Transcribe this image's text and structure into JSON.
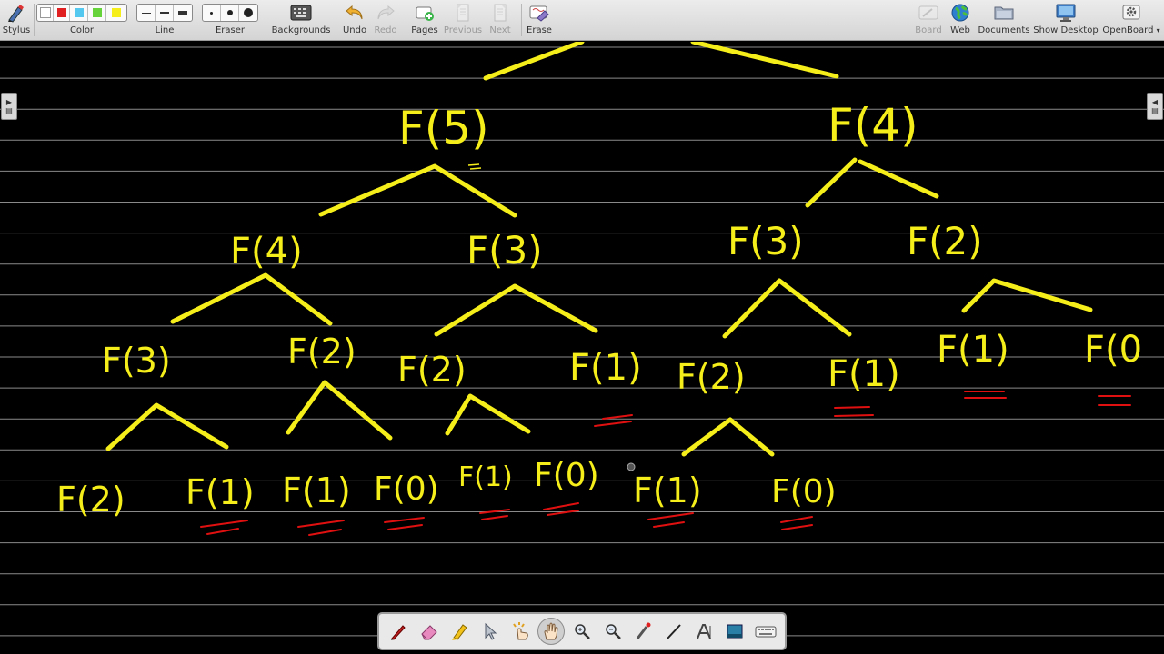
{
  "toolbar": {
    "stylus": "Stylus",
    "color": "Color",
    "line": "Line",
    "eraser": "Eraser",
    "backgrounds": "Backgrounds",
    "undo": "Undo",
    "redo": "Redo",
    "pages": "Pages",
    "previous": "Previous",
    "next": "Next",
    "erase": "Erase",
    "board": "Board",
    "web": "Web",
    "documents": "Documents",
    "show_desktop": "Show Desktop",
    "openboard": "OpenBoard"
  },
  "colors": {
    "swatches": [
      "#ffffff",
      "#e02020",
      "#55c8f0",
      "#66d33a",
      "#f5ee1a"
    ],
    "ink": "#f5ee1a",
    "underline": "#e01010",
    "background": "#000000"
  },
  "board": {
    "tree_labels": [
      {
        "id": "f5",
        "text": "F(5)"
      },
      {
        "id": "f4-top",
        "text": "F(4)"
      },
      {
        "id": "f4-l",
        "text": "F(4)"
      },
      {
        "id": "f3-a",
        "text": "F(3)"
      },
      {
        "id": "f3-b",
        "text": "F(3)"
      },
      {
        "id": "f2-a",
        "text": "F(2)"
      },
      {
        "id": "f3-c",
        "text": "F(3)"
      },
      {
        "id": "f2-b",
        "text": "F(2)"
      },
      {
        "id": "f2-c",
        "text": "F(2)"
      },
      {
        "id": "f1-a",
        "text": "F(1)"
      },
      {
        "id": "f2-d",
        "text": "F(2)"
      },
      {
        "id": "f1-b",
        "text": "F(1)"
      },
      {
        "id": "f1-c",
        "text": "F(1)"
      },
      {
        "id": "f0-a",
        "text": "F(0"
      },
      {
        "id": "f2-e",
        "text": "F(2)"
      },
      {
        "id": "f1-d",
        "text": "F(1)"
      },
      {
        "id": "f1-e",
        "text": "F(1)"
      },
      {
        "id": "f0-b",
        "text": "F(0)"
      },
      {
        "id": "f1-f",
        "text": "F(1)"
      },
      {
        "id": "f0-c",
        "text": "F(0)"
      },
      {
        "id": "f1-g",
        "text": "F(1)"
      },
      {
        "id": "f0-d",
        "text": "F(0)"
      }
    ]
  },
  "palette_tools": [
    "pen-icon",
    "eraser-icon",
    "marker-icon",
    "selector-icon",
    "interactor-icon",
    "hand-icon",
    "zoom-in-icon",
    "zoom-out-icon",
    "laser-pointer-icon",
    "line-icon",
    "text-icon",
    "capture-icon",
    "keyboard-icon"
  ]
}
